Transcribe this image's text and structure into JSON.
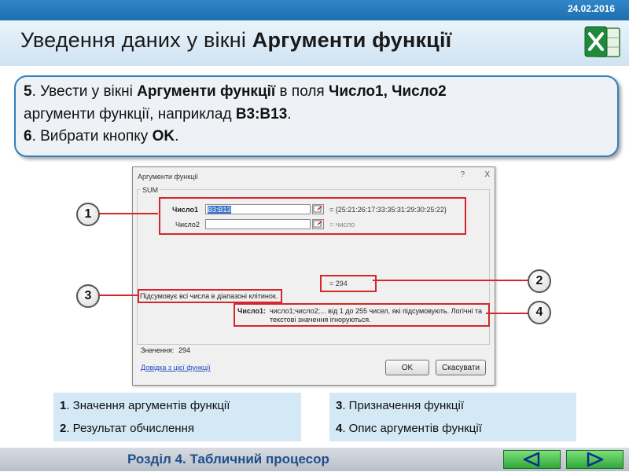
{
  "header": {
    "date": "24.02.2016"
  },
  "slide": {
    "title_prefix": "Уведення даних у вікні",
    "title_bold": "Аргументи функції"
  },
  "instructions": {
    "l1_num": "5",
    "l1_text": ". Увести у вікні ",
    "l1_bold1": "Аргументи функції",
    "l1_mid": " в поля ",
    "l1_bold2": "Число1, Число2",
    "l2_text": "аргументи функції, наприклад ",
    "l2_bold": "B3:B13",
    "l2_end": ".",
    "l3_num": "6",
    "l3_text": ". Вибрати кнопку ",
    "l3_bold": "OK",
    "l3_end": "."
  },
  "dialog": {
    "caption": "Аргументи функції",
    "help_glyph": "?",
    "close_glyph": "X",
    "function_name": "SUM",
    "field1_label": "Число1",
    "field1_value": "B3:B13",
    "field1_result": "= {25:21:26:17:33:35:31:29:30:25:22}",
    "field2_label": "Число2",
    "field2_value": "",
    "field2_result": "= число",
    "result": "= 294",
    "description": "Підсумовує всі числа в діапазоні клітинок.",
    "arg_name": "Число1:",
    "arg_desc_line1": "число1;число2;... від 1 до 255 чисел, які підсумовують. Логічні та",
    "arg_desc_line2": "текстові значення ігноруються.",
    "value_label": "Значення:",
    "value": "294",
    "help_link": "Довідка з цієї функції",
    "ok_label": "OK",
    "cancel_label": "Скасувати"
  },
  "callouts": [
    "1",
    "2",
    "3",
    "4"
  ],
  "legend_left": [
    {
      "num": "1",
      "text": ". Значення аргументів функції"
    },
    {
      "num": "2",
      "text": ". Результат обчислення"
    }
  ],
  "legend_right": [
    {
      "num": "3",
      "text": ". Призначення функції"
    },
    {
      "num": "4",
      "text": ". Опис аргументів функції"
    }
  ],
  "footer": {
    "section": "Розділ 4. Табличний процесор"
  },
  "colors": {
    "accent": "#2f7fc1",
    "highlight_red": "#d3272a",
    "nav_green": "#2fa83a"
  },
  "icons": [
    "excel-logo-icon",
    "range-picker-icon",
    "prev-arrow-icon",
    "next-arrow-icon"
  ]
}
